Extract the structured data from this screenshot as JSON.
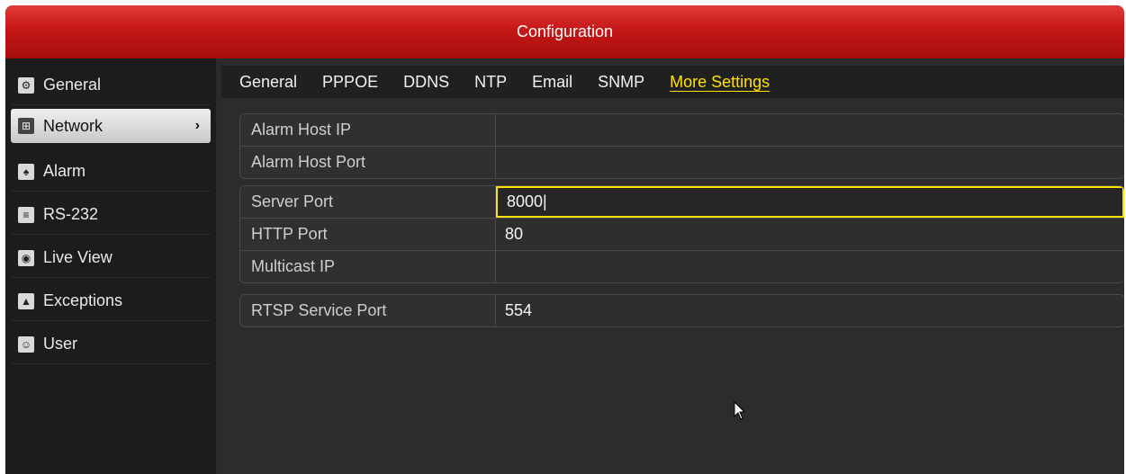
{
  "window": {
    "title": "Configuration"
  },
  "sidebar": {
    "items": [
      {
        "label": "General",
        "icon": "gear-icon"
      },
      {
        "label": "Network",
        "icon": "network-icon",
        "active": true,
        "chevron": "›"
      },
      {
        "label": "Alarm",
        "icon": "alarm-icon"
      },
      {
        "label": "RS-232",
        "icon": "rs232-icon"
      },
      {
        "label": "Live View",
        "icon": "eye-icon"
      },
      {
        "label": "Exceptions",
        "icon": "warning-icon"
      },
      {
        "label": "User",
        "icon": "users-icon"
      }
    ]
  },
  "tabs": [
    "General",
    "PPPOE",
    "DDNS",
    "NTP",
    "Email",
    "SNMP",
    "More Settings"
  ],
  "active_tab": "More Settings",
  "fields": {
    "alarm_host_ip": {
      "label": "Alarm Host IP",
      "value": ""
    },
    "alarm_host_port": {
      "label": "Alarm Host Port",
      "value": ""
    },
    "server_port": {
      "label": "Server Port",
      "value": "8000|"
    },
    "http_port": {
      "label": "HTTP Port",
      "value": "80"
    },
    "multicast_ip": {
      "label": "Multicast IP",
      "value": ""
    },
    "rtsp_service_port": {
      "label": "RTSP Service Port",
      "value": "554"
    }
  },
  "colors": {
    "title_red": "#c61717",
    "active_tab": "#ffe100",
    "focus_border": "#ffe100"
  }
}
